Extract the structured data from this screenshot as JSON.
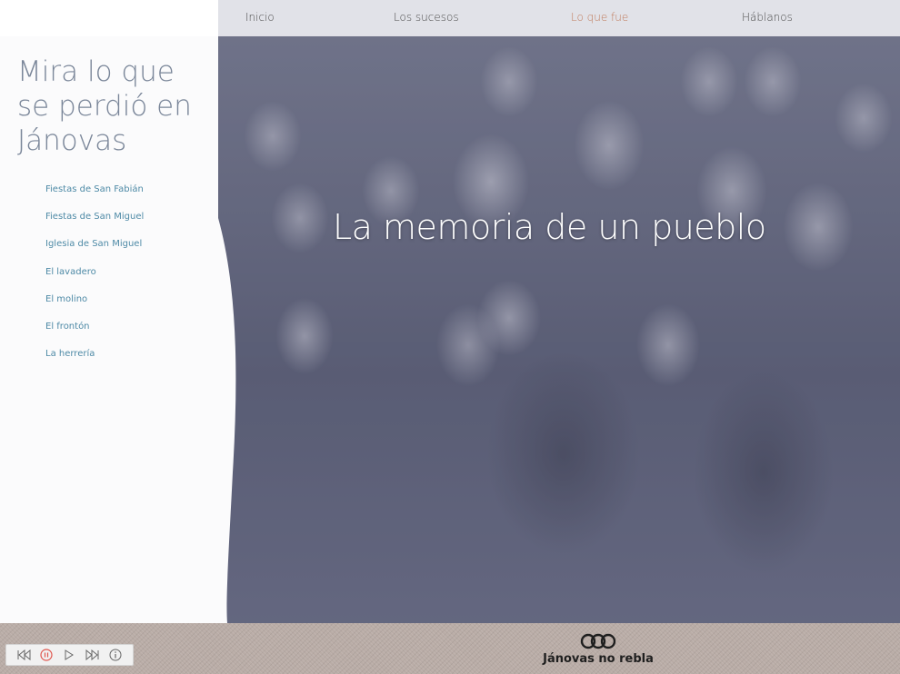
{
  "nav": {
    "items": [
      {
        "label": "Inicio",
        "active": false
      },
      {
        "label": "Los sucesos",
        "active": false
      },
      {
        "label": "Lo que fue",
        "active": true
      },
      {
        "label": "Háblanos",
        "active": false
      }
    ],
    "active_color": "#c07a5a"
  },
  "sidebar": {
    "title": "Mira lo que se perdió en Jánovas",
    "links": [
      "Fiestas de San Fabián",
      "Fiestas de San Miguel",
      "Iglesia de San Miguel",
      "El lavadero",
      "El molino",
      "El frontón",
      "La herrería"
    ],
    "link_color": "#4e8aa6"
  },
  "hero": {
    "title": "La memoria de un pueblo"
  },
  "player": {
    "controls": [
      "previous-icon",
      "pause-icon",
      "play-icon",
      "next-icon",
      "info-icon"
    ],
    "pause_color": "#e0574f"
  },
  "footer": {
    "brand_name": "Jánovas no rebla",
    "logo": "brand-logo-icon"
  }
}
